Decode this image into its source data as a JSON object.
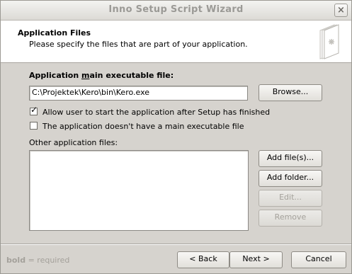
{
  "window": {
    "title": "Inno Setup Script Wizard",
    "close_icon": "close-icon"
  },
  "header": {
    "title": "Application Files",
    "subtitle": "Please specify the files that are part of your application.",
    "icon": "wizard-pages-icon"
  },
  "main": {
    "exe_label_before": "Application ",
    "exe_label_underlined": "m",
    "exe_label_after": "ain executable file:",
    "exe_value": "C:\\Projektek\\Kero\\bin\\Kero.exe",
    "browse_label": "Browse...",
    "allow_start": {
      "label": "Allow user to start the application after Setup has finished",
      "checked": true
    },
    "no_exe": {
      "label": "The application doesn't have a main executable file",
      "checked": false
    },
    "other_files_label": "Other application files:",
    "other_files": [],
    "add_files_label": "Add file(s)...",
    "add_folder_label": "Add folder...",
    "edit_label": "Edit...",
    "remove_label": "Remove"
  },
  "footer": {
    "legend_bold": "bold",
    "legend_rest": " = required",
    "back_label": "< Back",
    "next_label": "Next >",
    "cancel_label": "Cancel"
  }
}
